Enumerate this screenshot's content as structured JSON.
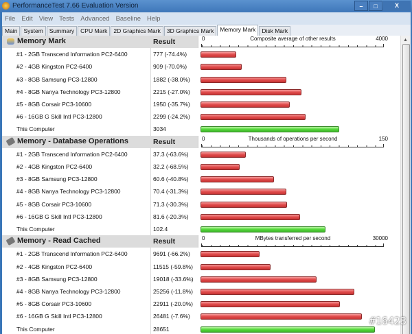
{
  "window": {
    "title": "PerformanceTest 7.66 Evaluation Version"
  },
  "menu": [
    "File",
    "Edit",
    "View",
    "Tests",
    "Advanced",
    "Baseline",
    "Help"
  ],
  "tabs": [
    "Main",
    "System",
    "Summary",
    "CPU Mark",
    "2D Graphics Mark",
    "3D Graphics Mark",
    "Memory Mark",
    "Disk Mark"
  ],
  "active_tab": "Memory Mark",
  "result_header": "Result",
  "colors": {
    "bar": "#e04b4b",
    "this_computer": "#54d83a"
  },
  "sections": [
    {
      "title": "Memory Mark",
      "axis_label": "Composite average of other results",
      "axis_min": "0",
      "axis_max": "4000",
      "max": 4000,
      "rows": [
        {
          "name": "#1 - 2GB Transcend Information PC2-6400",
          "result": "777 (-74.4%)",
          "value": 777
        },
        {
          "name": "#2 - 4GB Kingston PC2-6400",
          "result": "909 (-70.0%)",
          "value": 909
        },
        {
          "name": "#3 - 8GB Samsung PC3-12800",
          "result": "1882 (-38.0%)",
          "value": 1882
        },
        {
          "name": "#4 - 8GB Nanya Technology PC3-12800",
          "result": "2215 (-27.0%)",
          "value": 2215
        },
        {
          "name": "#5 - 8GB Corsair PC3-10600",
          "result": "1950 (-35.7%)",
          "value": 1950
        },
        {
          "name": "#6 - 16GB G Skill Intl PC3-12800",
          "result": "2299 (-24.2%)",
          "value": 2299
        },
        {
          "name": "This Computer",
          "result": "3034",
          "value": 3034,
          "self": true
        }
      ]
    },
    {
      "title": "Memory - Database Operations",
      "axis_label": "Thousands of operations per second",
      "axis_min": "0",
      "axis_max": "150",
      "max": 150,
      "rows": [
        {
          "name": "#1 - 2GB Transcend Information PC2-6400",
          "result": "37.3 (-63.6%)",
          "value": 37.3
        },
        {
          "name": "#2 - 4GB Kingston PC2-6400",
          "result": "32.2 (-68.5%)",
          "value": 32.2
        },
        {
          "name": "#3 - 8GB Samsung PC3-12800",
          "result": "60.6 (-40.8%)",
          "value": 60.6
        },
        {
          "name": "#4 - 8GB Nanya Technology PC3-12800",
          "result": "70.4 (-31.3%)",
          "value": 70.4
        },
        {
          "name": "#5 - 8GB Corsair PC3-10600",
          "result": "71.3 (-30.3%)",
          "value": 71.3
        },
        {
          "name": "#6 - 16GB G Skill Intl PC3-12800",
          "result": "81.6 (-20.3%)",
          "value": 81.6
        },
        {
          "name": "This Computer",
          "result": "102.4",
          "value": 102.4,
          "self": true
        }
      ]
    },
    {
      "title": "Memory - Read Cached",
      "axis_label": "MBytes transferred per second",
      "axis_min": "0",
      "axis_max": "30000",
      "max": 30000,
      "rows": [
        {
          "name": "#1 - 2GB Transcend Information PC2-6400",
          "result": "9691 (-66.2%)",
          "value": 9691
        },
        {
          "name": "#2 - 4GB Kingston PC2-6400",
          "result": "11515 (-59.8%)",
          "value": 11515
        },
        {
          "name": "#3 - 8GB Samsung PC3-12800",
          "result": "19018 (-33.6%)",
          "value": 19018
        },
        {
          "name": "#4 - 8GB Nanya Technology PC3-12800",
          "result": "25256 (-11.8%)",
          "value": 25256
        },
        {
          "name": "#5 - 8GB Corsair PC3-10600",
          "result": "22911 (-20.0%)",
          "value": 22911
        },
        {
          "name": "#6 - 16GB G Skill Intl PC3-12800",
          "result": "26481 (-7.6%)",
          "value": 26481
        },
        {
          "name": "This Computer",
          "result": "28651",
          "value": 28651,
          "self": true
        }
      ]
    }
  ],
  "watermark": "#16423"
}
